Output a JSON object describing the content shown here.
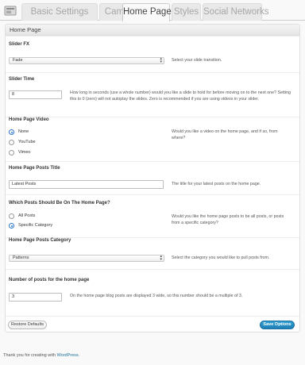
{
  "tabs": [
    {
      "label": "Basic Settings",
      "active": false
    },
    {
      "label": "Campaign",
      "active": false
    },
    {
      "label": "Home Page",
      "active": true
    },
    {
      "label": "Styles",
      "active": false
    },
    {
      "label": "Social Networks",
      "active": false
    }
  ],
  "panel": {
    "title": "Home Page"
  },
  "slider_fx": {
    "label": "Slider FX",
    "value": "Fade",
    "description": "Select your slide transition."
  },
  "slider_time": {
    "label": "Slider Time",
    "value": "8",
    "description": "How long in seconds (use a whole number) would you like a slide to hold for before moving on to the next one? Setting this to 0 (zero) will not autoplay the slides. Zero is recommended if you are using videos in your slider."
  },
  "home_page_video": {
    "label": "Home Page Video",
    "options": [
      "None",
      "YouTube",
      "Vimeo"
    ],
    "selected": "None",
    "description": "Would you like a video on the home page, and if so, from where?"
  },
  "posts_title": {
    "label": "Home Page Posts Title",
    "value": "Latest Posts",
    "description": "The title for your latest posts on the home page."
  },
  "posts_source": {
    "label": "Which Posts Should Be On The Home Page?",
    "options": [
      "All Posts",
      "Specific Category"
    ],
    "selected": "Specific Category",
    "description": "Would you like the home page posts to be all posts, or posts from a specific category?"
  },
  "posts_category": {
    "label": "Home Page Posts Category",
    "value": "Patterns",
    "description": "Select the category you would like to pull posts from."
  },
  "posts_count": {
    "label": "Number of posts for the home page",
    "value": "3",
    "description": "On the home page blog posts are displayed 3 wide, so this number should be a multiple of 3."
  },
  "buttons": {
    "restore": "Restore Defaults",
    "save": "Save Options"
  },
  "credit": {
    "text": "Thank you for creating with ",
    "link": "WordPress",
    "suffix": "."
  },
  "colors": {
    "accent": "#2a75c9",
    "primary_button": "#2185bf",
    "link": "#21759b"
  }
}
